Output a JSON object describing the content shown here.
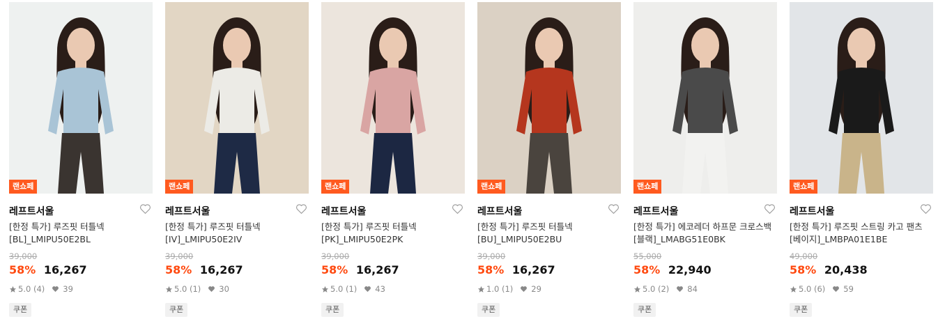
{
  "products": [
    {
      "badge": "랜쇼페",
      "brand": "레프트서울",
      "title_line1": "[한정 특가] 루즈핏 터틀넥",
      "title_line2": "[BL]_LMIPU50E2BL",
      "original_price": "39,000",
      "discount": "58%",
      "price": "16,267",
      "rating": "5.0",
      "reviews": "(4)",
      "likes": "39",
      "coupon": "쿠폰",
      "colors": {
        "bg": "#e9eceb",
        "top": "#a9c4d6",
        "bottom": "#3a3430",
        "hair": "#2a1d18"
      }
    },
    {
      "badge": "랜쇼페",
      "brand": "레프트서울",
      "title_line1": "[한정 특가] 루즈핏 터틀넥",
      "title_line2": "[IV]_LMIPU50E2IV",
      "original_price": "39,000",
      "discount": "58%",
      "price": "16,267",
      "rating": "5.0",
      "reviews": "(1)",
      "likes": "30",
      "coupon": "쿠폰",
      "colors": {
        "bg": "#d9c8b0",
        "top": "#ecebe6",
        "bottom": "#1e2a45",
        "hair": "#2a1d18"
      }
    },
    {
      "badge": "랜쇼페",
      "brand": "레프트서울",
      "title_line1": "[한정 특가] 루즈핏 터틀넥",
      "title_line2": "[PK]_LMIPU50E2PK",
      "original_price": "39,000",
      "discount": "58%",
      "price": "16,267",
      "rating": "5.0",
      "reviews": "(1)",
      "likes": "43",
      "coupon": "쿠폰",
      "colors": {
        "bg": "#e6ddd2",
        "top": "#d9a5a3",
        "bottom": "#1c2742",
        "hair": "#2a1d18"
      }
    },
    {
      "badge": "랜쇼페",
      "brand": "레프트서울",
      "title_line1": "[한정 특가] 루즈핏 터틀넥",
      "title_line2": "[BU]_LMIPU50E2BU",
      "original_price": "39,000",
      "discount": "58%",
      "price": "16,267",
      "rating": "1.0",
      "reviews": "(1)",
      "likes": "29",
      "coupon": "쿠폰",
      "colors": {
        "bg": "#cfc2b1",
        "top": "#b5361e",
        "bottom": "#4a443e",
        "hair": "#2a1d18"
      }
    },
    {
      "badge": "랜쇼페",
      "brand": "레프트서울",
      "title_line1": "[한정 특가] 에코레더 하프문 크로스백",
      "title_line2": "[블랙]_LMABG51E0BK",
      "original_price": "55,000",
      "discount": "58%",
      "price": "22,940",
      "rating": "5.0",
      "reviews": "(2)",
      "likes": "84",
      "coupon": "쿠폰",
      "colors": {
        "bg": "#e8e8e6",
        "top": "#4a4a4a",
        "bottom": "#f2f2f0",
        "hair": "#2a1d18"
      }
    },
    {
      "badge": "랜쇼페",
      "brand": "레프트서울",
      "title_line1": "[한정 특가] 루즈핏 스트링 카고 팬츠",
      "title_line2": "[베이지]_LMBPA01E1BE",
      "original_price": "49,000",
      "discount": "58%",
      "price": "20,438",
      "rating": "5.0",
      "reviews": "(6)",
      "likes": "59",
      "coupon": "쿠폰",
      "colors": {
        "bg": "#d8dde0",
        "top": "#1a1a1a",
        "bottom": "#c9b48a",
        "hair": "#2a1d18"
      }
    }
  ],
  "theme": {
    "accent": "#ff4a10",
    "badge_bg": "#ff5a1f"
  },
  "icons": {
    "wishlist": "heart-outline-icon",
    "rating": "star-icon",
    "likes": "heart-filled-icon"
  }
}
